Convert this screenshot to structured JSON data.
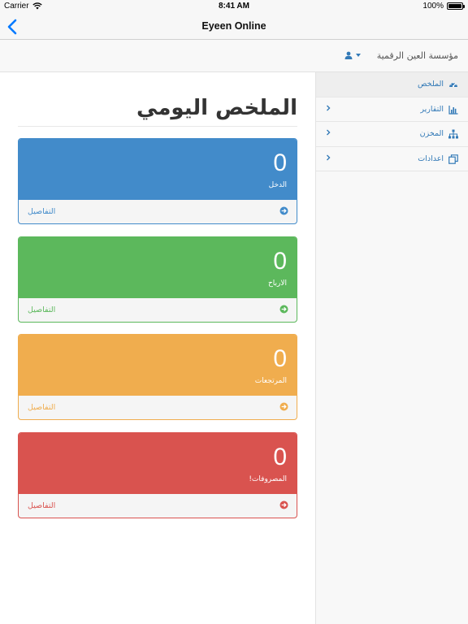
{
  "status_bar": {
    "carrier": "Carrier",
    "time": "8:41 AM",
    "battery": "100%",
    "battery_level": 1.0,
    "wifi_icon": "wifi-icon",
    "battery_icon": "battery-icon"
  },
  "nav": {
    "title": "Eyeen Online",
    "back_icon": "chevron-left-icon"
  },
  "header": {
    "org_name": "مؤسسة العين الرقمية",
    "user_icon": "user-icon"
  },
  "sidebar": {
    "items": [
      {
        "label": "الملخص",
        "icon": "dashboard-icon",
        "active": true,
        "has_submenu": false
      },
      {
        "label": "التقارير",
        "icon": "bar-chart-icon",
        "active": false,
        "has_submenu": true
      },
      {
        "label": "المخزن",
        "icon": "sitemap-icon",
        "active": false,
        "has_submenu": true
      },
      {
        "label": "اعدادات",
        "icon": "copy-icon",
        "active": false,
        "has_submenu": true
      }
    ]
  },
  "main": {
    "title": "الملخص اليومي",
    "cards": [
      {
        "value": "0",
        "label": "الدخل",
        "footer": "التفاصيل",
        "color": "#428bca"
      },
      {
        "value": "0",
        "label": "الارباح",
        "footer": "التفاصيل",
        "color": "#5cb85c"
      },
      {
        "value": "0",
        "label": "المرتجعات",
        "footer": "التفاصيل",
        "color": "#f0ad4e"
      },
      {
        "value": "0",
        "label": "المصروفات!",
        "footer": "التفاصيل",
        "color": "#d9534f"
      }
    ]
  },
  "colors": {
    "accent": "#337ab7",
    "ios_blue": "#007aff"
  }
}
